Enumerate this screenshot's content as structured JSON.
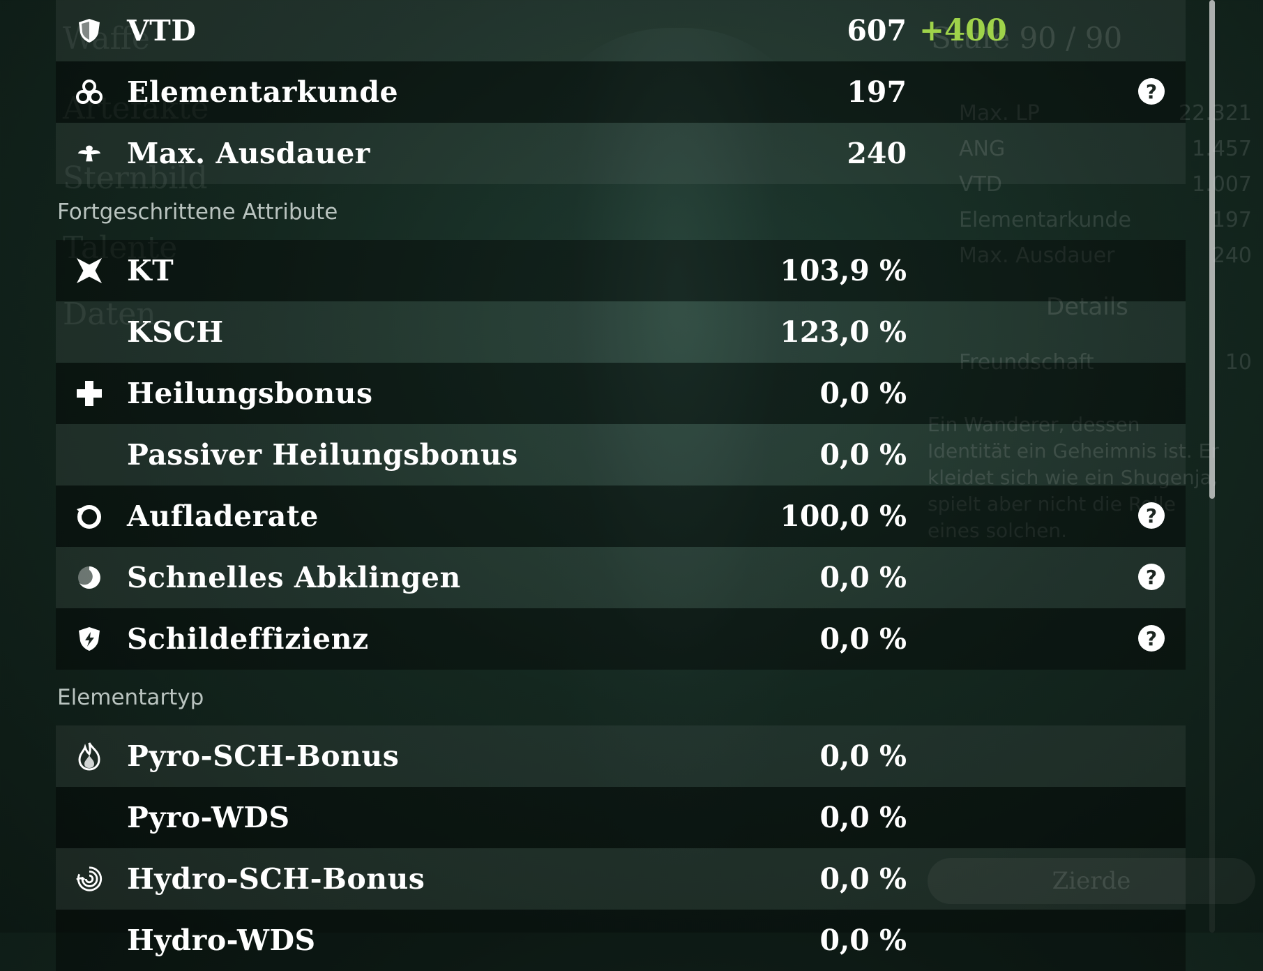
{
  "background": {
    "level": "Stufe 90 / 90",
    "stats": [
      {
        "label": "Max. LP",
        "value": "22.321"
      },
      {
        "label": "ANG",
        "value": "1.457"
      },
      {
        "label": "VTD",
        "value": "1.007"
      },
      {
        "label": "Elementarkunde",
        "value": "197"
      },
      {
        "label": "Max. Ausdauer",
        "value": "240"
      }
    ],
    "details": "Details",
    "friendship": {
      "label": "Freundschaft",
      "value": "10"
    },
    "description": "Ein Wanderer, dessen Identität ein Geheimnis ist. Er kleidet sich wie ein Shugenja, spielt aber nicht die Rolle eines solchen.",
    "left_menu": [
      "Waffe",
      "Artefakte",
      "Sternbild",
      "Talente",
      "Daten"
    ],
    "zierde_label": "Zierde"
  },
  "stats_top": [
    {
      "icon": "shield-icon",
      "label": "VTD",
      "value": "607",
      "bonus": "+400",
      "help": false
    },
    {
      "icon": "elemental-mastery-icon",
      "label": "Elementarkunde",
      "value": "197",
      "help": true
    },
    {
      "icon": "stamina-icon",
      "label": "Max. Ausdauer",
      "value": "240",
      "help": false
    }
  ],
  "sections": {
    "advanced": "Fortgeschrittene Attribute",
    "element": "Elementartyp"
  },
  "stats_advanced": [
    {
      "icon": "crit-icon",
      "label": "KT",
      "value": "103,9 %",
      "help": false
    },
    {
      "icon": "",
      "label": "KSCH",
      "value": "123,0 %",
      "help": false
    },
    {
      "icon": "healing-cross-icon",
      "label": "Heilungsbonus",
      "value": "0,0 %",
      "help": false
    },
    {
      "icon": "",
      "label": "Passiver Heilungsbonus",
      "value": "0,0 %",
      "help": false
    },
    {
      "icon": "energy-recharge-icon",
      "label": "Aufladerate",
      "value": "100,0 %",
      "help": true
    },
    {
      "icon": "cooldown-icon",
      "label": "Schnelles Abklingen",
      "value": "0,0 %",
      "help": true
    },
    {
      "icon": "shield-strength-icon",
      "label": "Schildeffizienz",
      "value": "0,0 %",
      "help": true
    }
  ],
  "stats_element": [
    {
      "icon": "pyro-icon",
      "label": "Pyro-SCH-Bonus",
      "value": "0,0 %"
    },
    {
      "icon": "",
      "label": "Pyro-WDS",
      "value": "0,0 %"
    },
    {
      "icon": "hydro-icon",
      "label": "Hydro-SCH-Bonus",
      "value": "0,0 %"
    },
    {
      "icon": "",
      "label": "Hydro-WDS",
      "value": "0,0 %"
    }
  ],
  "help_glyph": "?",
  "colors": {
    "bonus": "#9fd34a",
    "section_text": "#b9c3bf"
  }
}
